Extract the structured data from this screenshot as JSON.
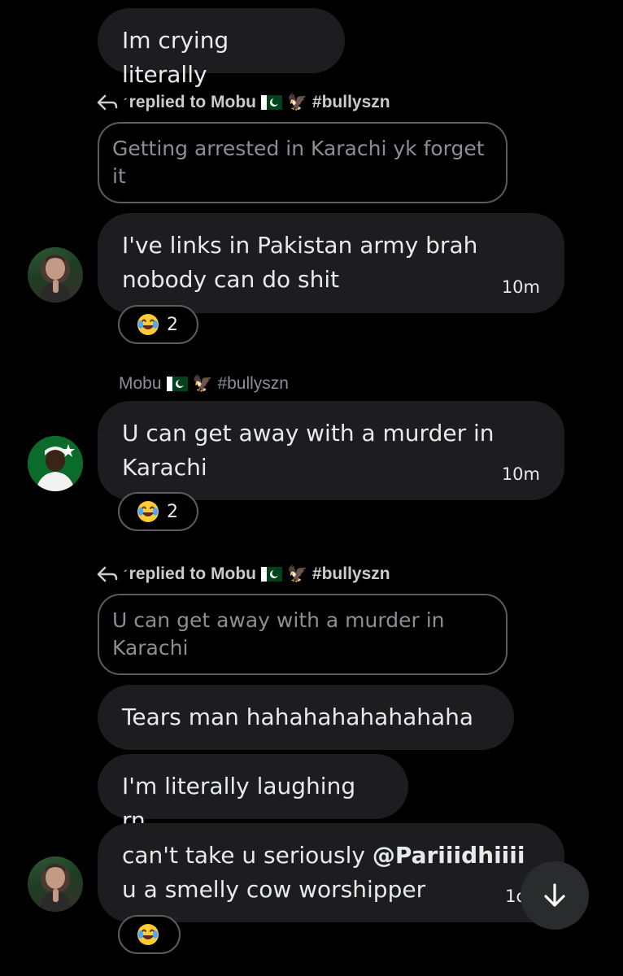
{
  "colors": {
    "background": "#000000",
    "bubble": "#1d1d1f",
    "text": "#e7e9ea",
    "muted": "#8a8f93",
    "border": "#5a5d60"
  },
  "messages": {
    "m1": {
      "text": "Im crying literally"
    },
    "reply1": {
      "label": "replied to Mobu",
      "hashtag": "#bullyszn",
      "quoted": "Getting arrested in Karachi yk forget it"
    },
    "m2": {
      "line1": "I've links in Pakistan army brah",
      "line2": "nobody can do shit",
      "time": "10m",
      "reaction_count": "2"
    },
    "sender2": {
      "name": "Mobu",
      "hashtag": "#bullyszn"
    },
    "m3": {
      "line1": "U can get away with a murder in",
      "line2": "Karachi",
      "time": "10m",
      "reaction_count": "2"
    },
    "reply2": {
      "label": "replied to Mobu",
      "hashtag": "#bullyszn",
      "quoted_line1": "U can get away with a murder in",
      "quoted_line2": "Karachi"
    },
    "m4": {
      "text": "Tears man hahahahahahahaha"
    },
    "m5": {
      "text": "I'm literally laughing rn"
    },
    "m6": {
      "line1_prefix": "can't take u seriously ",
      "mention": "@Pariiidhiiii",
      "line2": "u a smelly cow worshipper",
      "time": "1c"
    }
  },
  "icons": [
    "reply-arrow-icon",
    "pakistan-flag-icon",
    "eagle-icon",
    "laughing-emoji-icon",
    "arrow-down-icon"
  ]
}
